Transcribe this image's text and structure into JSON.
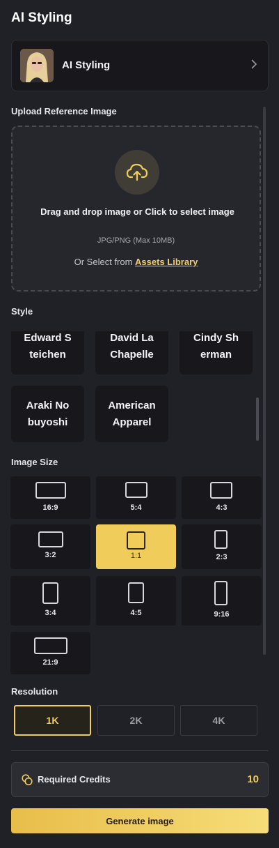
{
  "page": {
    "title": "AI Styling"
  },
  "model": {
    "label": "AI Styling"
  },
  "upload": {
    "section_label": "Upload Reference Image",
    "main_text": "Drag and drop image or Click to select image",
    "sub_text": "JPG/PNG (Max 10MB)",
    "or_text": "Or Select from",
    "assets_link": "Assets Library"
  },
  "style": {
    "section_label": "Style",
    "items": [
      {
        "label": "Edward S teichen"
      },
      {
        "label": "David La Chapelle"
      },
      {
        "label": "Cindy Sh erman"
      },
      {
        "label": "Araki No buyoshi"
      },
      {
        "label": "American Apparel"
      }
    ]
  },
  "image_size": {
    "section_label": "Image Size",
    "selected": "1:1",
    "options": [
      {
        "label": "16:9"
      },
      {
        "label": "5:4"
      },
      {
        "label": "4:3"
      },
      {
        "label": "3:2"
      },
      {
        "label": "1:1"
      },
      {
        "label": "2:3"
      },
      {
        "label": "3:4"
      },
      {
        "label": "4:5"
      },
      {
        "label": "9:16"
      },
      {
        "label": "21:9"
      }
    ]
  },
  "resolution": {
    "section_label": "Resolution",
    "selected": "1K",
    "options": [
      {
        "label": "1K"
      },
      {
        "label": "2K"
      },
      {
        "label": "4K"
      }
    ]
  },
  "credits": {
    "label": "Required Credits",
    "value": "10"
  },
  "generate": {
    "label": "Generate image"
  },
  "colors": {
    "background": "#202127",
    "card": "#18181c",
    "accent": "#f0cd5b",
    "link": "#f0cd66"
  }
}
